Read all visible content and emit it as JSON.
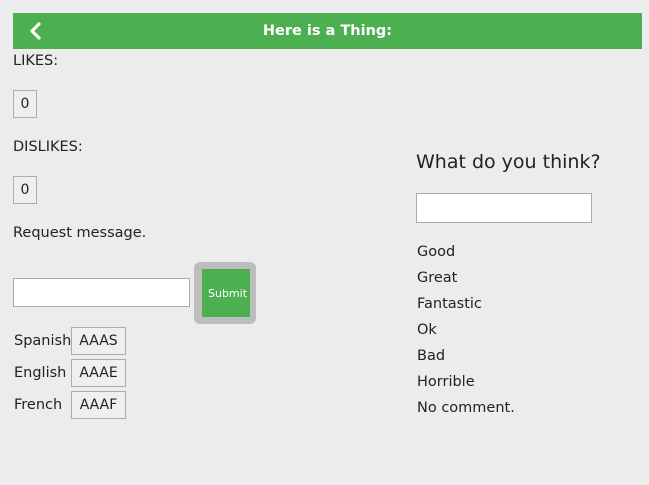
{
  "header": {
    "title": "Here is a Thing:",
    "back_icon": "chevron-left-icon",
    "color": "#4caf50"
  },
  "likes": {
    "label": "LIKES:",
    "count": "0"
  },
  "dislikes": {
    "label": "DISLIKES:",
    "count": "0"
  },
  "request": {
    "label": "Request message.",
    "input_value": "",
    "submit_label": "Submit"
  },
  "languages": [
    {
      "name": "Spanish",
      "button": "AAAS"
    },
    {
      "name": "English",
      "button": "AAAE"
    },
    {
      "name": "French",
      "button": "AAAF"
    }
  ],
  "feedback": {
    "question": "What do you think?",
    "input_value": "",
    "options": [
      "Good",
      "Great",
      "Fantastic",
      "Ok",
      "Bad",
      "Horrible",
      "No comment."
    ]
  }
}
